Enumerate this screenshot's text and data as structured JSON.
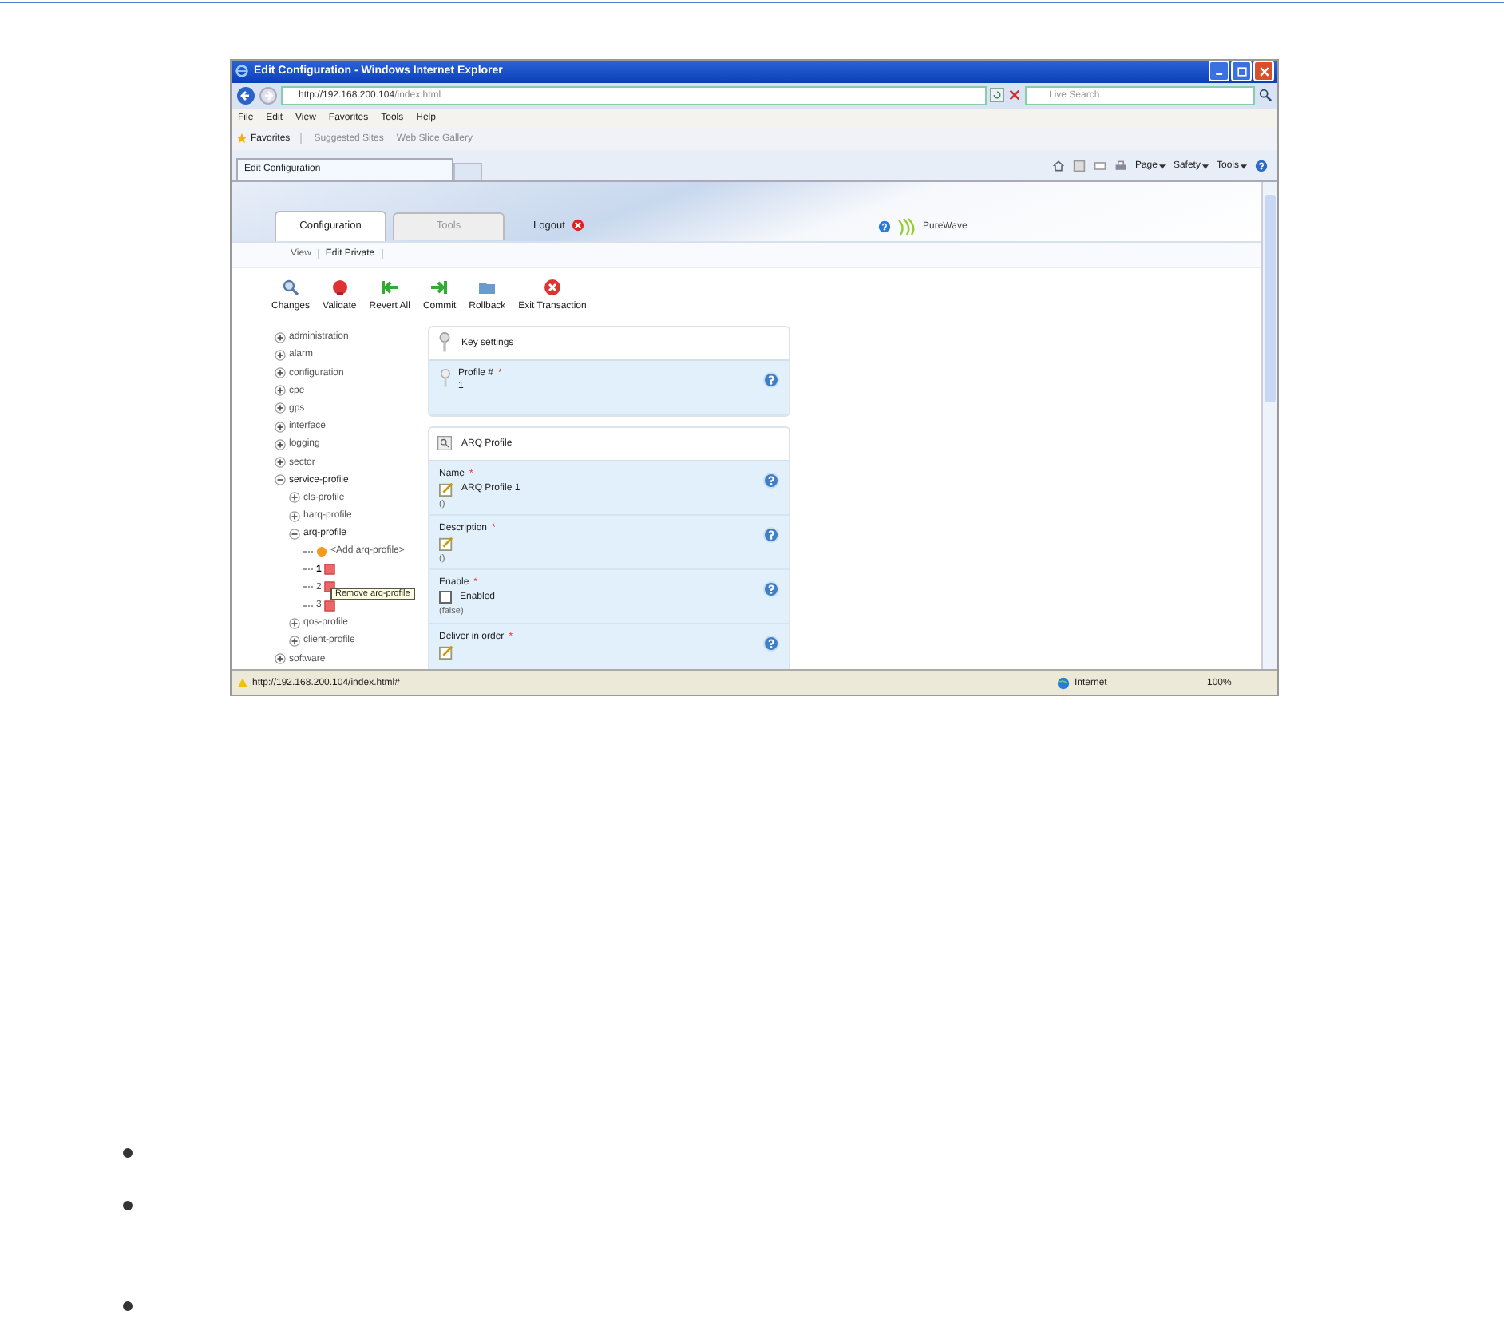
{
  "window": {
    "title": "Edit Configuration - Windows Internet Explorer"
  },
  "address_bar": {
    "url_host": "http://192.168.200.104",
    "url_path": "/index.html",
    "search_placeholder": "Live Search"
  },
  "menu": [
    "File",
    "Edit",
    "View",
    "Favorites",
    "Tools",
    "Help"
  ],
  "favorites_bar": {
    "label": "Favorites",
    "links": [
      "Suggested Sites",
      "Web Slice Gallery"
    ]
  },
  "browser_tab": {
    "title": "Edit Configuration"
  },
  "command_bar": [
    "Page",
    "Safety",
    "Tools"
  ],
  "app": {
    "tabs": [
      {
        "label": "Configuration",
        "selected": true
      },
      {
        "label": "Tools",
        "selected": false
      }
    ],
    "logout": "Logout",
    "brand": "PureWave",
    "subnav": [
      {
        "label": "View",
        "selected": false
      },
      {
        "label": "Edit Private",
        "selected": true
      }
    ],
    "actions": [
      {
        "kind": "search",
        "label": "Changes"
      },
      {
        "kind": "validate",
        "label": "Validate"
      },
      {
        "kind": "revert",
        "label": "Revert All"
      },
      {
        "kind": "commit",
        "label": "Commit"
      },
      {
        "kind": "rollback",
        "label": "Rollback"
      },
      {
        "kind": "exit",
        "label": "Exit Transaction"
      }
    ],
    "tree": [
      {
        "kind": "group",
        "label": "administration",
        "expanded": false
      },
      {
        "kind": "group",
        "label": "alarm",
        "expanded": false
      },
      {
        "kind": "group",
        "label": "configuration",
        "expanded": false
      },
      {
        "kind": "group",
        "label": "cpe",
        "expanded": false
      },
      {
        "kind": "group",
        "label": "gps",
        "expanded": false
      },
      {
        "kind": "group",
        "label": "interface",
        "expanded": false
      },
      {
        "kind": "group",
        "label": "logging",
        "expanded": false
      },
      {
        "kind": "group",
        "label": "sector",
        "expanded": false
      },
      {
        "kind": "group",
        "label": "service-profile",
        "expanded": true,
        "children": [
          {
            "kind": "group",
            "label": "cls-profile",
            "expanded": false
          },
          {
            "kind": "group",
            "label": "harq-profile",
            "expanded": false
          },
          {
            "kind": "group",
            "label": "arq-profile",
            "expanded": true,
            "children": [
              {
                "kind": "add",
                "label": "<Add arq-profile>"
              },
              {
                "kind": "entry",
                "label": "1",
                "selected": true
              },
              {
                "kind": "entry",
                "label": "2",
                "selected": false
              },
              {
                "kind": "entry",
                "label": "3",
                "selected": false
              }
            ]
          },
          {
            "kind": "group",
            "label": "qos-profile",
            "expanded": false
          },
          {
            "kind": "group",
            "label": "client-profile",
            "expanded": false
          }
        ]
      },
      {
        "kind": "group",
        "label": "software",
        "expanded": false
      }
    ],
    "tooltip": "Remove arq-profile",
    "panels": [
      {
        "kind": "key",
        "title": "Key settings",
        "fields": [
          {
            "kind": "text",
            "label": "Profile #",
            "required_mark": "*",
            "value": "1"
          }
        ]
      },
      {
        "kind": "form",
        "title": "ARQ Profile",
        "fields": [
          {
            "kind": "edit",
            "label": "Name",
            "required_mark": "*",
            "value": "ARQ Profile 1",
            "note": "()"
          },
          {
            "kind": "edit",
            "label": "Description",
            "required_mark": "*",
            "note": "()"
          },
          {
            "kind": "checkbox",
            "label": "Enable",
            "required_mark": "*",
            "option": "Enabled",
            "checked": false,
            "note": "(false)"
          },
          {
            "kind": "edit",
            "label": "Deliver in order",
            "required_mark": "*"
          }
        ]
      }
    ]
  },
  "status_bar": {
    "url": "http://192.168.200.104/index.html#",
    "zone": "Internet",
    "zoom": "100%"
  },
  "bullets": [
    {
      "kind": "dot"
    },
    {
      "kind": "dot"
    },
    {
      "kind": "dot"
    }
  ]
}
